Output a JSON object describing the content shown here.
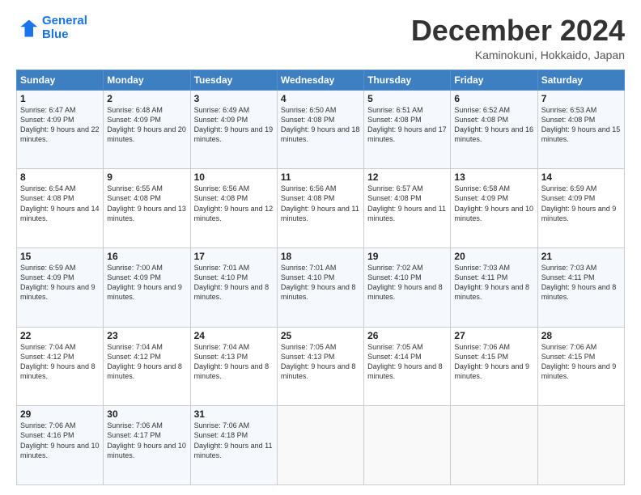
{
  "logo": {
    "line1": "General",
    "line2": "Blue"
  },
  "title": "December 2024",
  "location": "Kaminokuni, Hokkaido, Japan",
  "days_of_week": [
    "Sunday",
    "Monday",
    "Tuesday",
    "Wednesday",
    "Thursday",
    "Friday",
    "Saturday"
  ],
  "weeks": [
    [
      {
        "day": "1",
        "sunrise": "Sunrise: 6:47 AM",
        "sunset": "Sunset: 4:09 PM",
        "daylight": "Daylight: 9 hours and 22 minutes."
      },
      {
        "day": "2",
        "sunrise": "Sunrise: 6:48 AM",
        "sunset": "Sunset: 4:09 PM",
        "daylight": "Daylight: 9 hours and 20 minutes."
      },
      {
        "day": "3",
        "sunrise": "Sunrise: 6:49 AM",
        "sunset": "Sunset: 4:09 PM",
        "daylight": "Daylight: 9 hours and 19 minutes."
      },
      {
        "day": "4",
        "sunrise": "Sunrise: 6:50 AM",
        "sunset": "Sunset: 4:08 PM",
        "daylight": "Daylight: 9 hours and 18 minutes."
      },
      {
        "day": "5",
        "sunrise": "Sunrise: 6:51 AM",
        "sunset": "Sunset: 4:08 PM",
        "daylight": "Daylight: 9 hours and 17 minutes."
      },
      {
        "day": "6",
        "sunrise": "Sunrise: 6:52 AM",
        "sunset": "Sunset: 4:08 PM",
        "daylight": "Daylight: 9 hours and 16 minutes."
      },
      {
        "day": "7",
        "sunrise": "Sunrise: 6:53 AM",
        "sunset": "Sunset: 4:08 PM",
        "daylight": "Daylight: 9 hours and 15 minutes."
      }
    ],
    [
      {
        "day": "8",
        "sunrise": "Sunrise: 6:54 AM",
        "sunset": "Sunset: 4:08 PM",
        "daylight": "Daylight: 9 hours and 14 minutes."
      },
      {
        "day": "9",
        "sunrise": "Sunrise: 6:55 AM",
        "sunset": "Sunset: 4:08 PM",
        "daylight": "Daylight: 9 hours and 13 minutes."
      },
      {
        "day": "10",
        "sunrise": "Sunrise: 6:56 AM",
        "sunset": "Sunset: 4:08 PM",
        "daylight": "Daylight: 9 hours and 12 minutes."
      },
      {
        "day": "11",
        "sunrise": "Sunrise: 6:56 AM",
        "sunset": "Sunset: 4:08 PM",
        "daylight": "Daylight: 9 hours and 11 minutes."
      },
      {
        "day": "12",
        "sunrise": "Sunrise: 6:57 AM",
        "sunset": "Sunset: 4:08 PM",
        "daylight": "Daylight: 9 hours and 11 minutes."
      },
      {
        "day": "13",
        "sunrise": "Sunrise: 6:58 AM",
        "sunset": "Sunset: 4:09 PM",
        "daylight": "Daylight: 9 hours and 10 minutes."
      },
      {
        "day": "14",
        "sunrise": "Sunrise: 6:59 AM",
        "sunset": "Sunset: 4:09 PM",
        "daylight": "Daylight: 9 hours and 9 minutes."
      }
    ],
    [
      {
        "day": "15",
        "sunrise": "Sunrise: 6:59 AM",
        "sunset": "Sunset: 4:09 PM",
        "daylight": "Daylight: 9 hours and 9 minutes."
      },
      {
        "day": "16",
        "sunrise": "Sunrise: 7:00 AM",
        "sunset": "Sunset: 4:09 PM",
        "daylight": "Daylight: 9 hours and 9 minutes."
      },
      {
        "day": "17",
        "sunrise": "Sunrise: 7:01 AM",
        "sunset": "Sunset: 4:10 PM",
        "daylight": "Daylight: 9 hours and 8 minutes."
      },
      {
        "day": "18",
        "sunrise": "Sunrise: 7:01 AM",
        "sunset": "Sunset: 4:10 PM",
        "daylight": "Daylight: 9 hours and 8 minutes."
      },
      {
        "day": "19",
        "sunrise": "Sunrise: 7:02 AM",
        "sunset": "Sunset: 4:10 PM",
        "daylight": "Daylight: 9 hours and 8 minutes."
      },
      {
        "day": "20",
        "sunrise": "Sunrise: 7:03 AM",
        "sunset": "Sunset: 4:11 PM",
        "daylight": "Daylight: 9 hours and 8 minutes."
      },
      {
        "day": "21",
        "sunrise": "Sunrise: 7:03 AM",
        "sunset": "Sunset: 4:11 PM",
        "daylight": "Daylight: 9 hours and 8 minutes."
      }
    ],
    [
      {
        "day": "22",
        "sunrise": "Sunrise: 7:04 AM",
        "sunset": "Sunset: 4:12 PM",
        "daylight": "Daylight: 9 hours and 8 minutes."
      },
      {
        "day": "23",
        "sunrise": "Sunrise: 7:04 AM",
        "sunset": "Sunset: 4:12 PM",
        "daylight": "Daylight: 9 hours and 8 minutes."
      },
      {
        "day": "24",
        "sunrise": "Sunrise: 7:04 AM",
        "sunset": "Sunset: 4:13 PM",
        "daylight": "Daylight: 9 hours and 8 minutes."
      },
      {
        "day": "25",
        "sunrise": "Sunrise: 7:05 AM",
        "sunset": "Sunset: 4:13 PM",
        "daylight": "Daylight: 9 hours and 8 minutes."
      },
      {
        "day": "26",
        "sunrise": "Sunrise: 7:05 AM",
        "sunset": "Sunset: 4:14 PM",
        "daylight": "Daylight: 9 hours and 8 minutes."
      },
      {
        "day": "27",
        "sunrise": "Sunrise: 7:06 AM",
        "sunset": "Sunset: 4:15 PM",
        "daylight": "Daylight: 9 hours and 9 minutes."
      },
      {
        "day": "28",
        "sunrise": "Sunrise: 7:06 AM",
        "sunset": "Sunset: 4:15 PM",
        "daylight": "Daylight: 9 hours and 9 minutes."
      }
    ],
    [
      {
        "day": "29",
        "sunrise": "Sunrise: 7:06 AM",
        "sunset": "Sunset: 4:16 PM",
        "daylight": "Daylight: 9 hours and 10 minutes."
      },
      {
        "day": "30",
        "sunrise": "Sunrise: 7:06 AM",
        "sunset": "Sunset: 4:17 PM",
        "daylight": "Daylight: 9 hours and 10 minutes."
      },
      {
        "day": "31",
        "sunrise": "Sunrise: 7:06 AM",
        "sunset": "Sunset: 4:18 PM",
        "daylight": "Daylight: 9 hours and 11 minutes."
      },
      null,
      null,
      null,
      null
    ]
  ]
}
